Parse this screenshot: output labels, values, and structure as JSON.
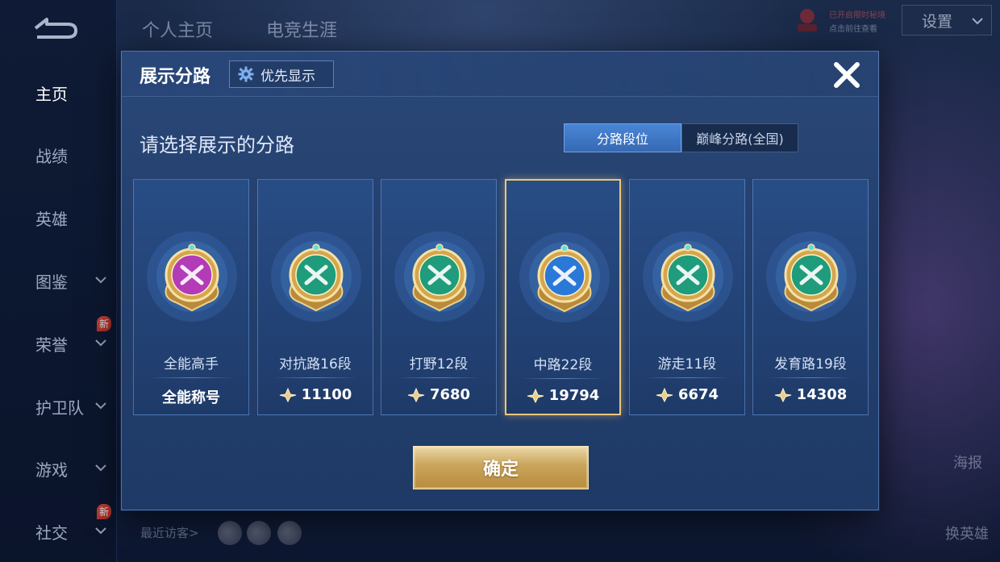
{
  "sidebar": {
    "items": [
      {
        "label": "主页",
        "active": true,
        "has_chevron": false
      },
      {
        "label": "战绩",
        "active": false,
        "has_chevron": false
      },
      {
        "label": "英雄",
        "active": false,
        "has_chevron": false
      },
      {
        "label": "图鉴",
        "active": false,
        "has_chevron": true
      },
      {
        "label": "荣誉",
        "active": false,
        "has_chevron": true,
        "new_tag": "新"
      },
      {
        "label": "护卫队",
        "active": false,
        "has_chevron": true
      },
      {
        "label": "游戏",
        "active": false,
        "has_chevron": true
      },
      {
        "label": "社交",
        "active": false,
        "has_chevron": true,
        "new_tag": "新"
      }
    ]
  },
  "top_tabs": [
    "个人主页",
    "电竞生涯"
  ],
  "header_right": {
    "vip_line1": "已开启限时秘境",
    "vip_line2": "点击前往查看",
    "settings_label": "设置"
  },
  "footer": {
    "recent_visitors_label": "最近访客>",
    "poster_label": "海报",
    "change_hero_label": "换英雄"
  },
  "modal": {
    "title": "展示分路",
    "priority_button_label": "优先显示",
    "prompt": "请选择展示的分路",
    "segments": [
      {
        "label": "分路段位",
        "active": true
      },
      {
        "label": "巅峰分路(全国)",
        "active": false
      }
    ],
    "cards": [
      {
        "rank": "全能高手",
        "score": "全能称号",
        "show_gem": false,
        "selected": false,
        "badge_icon": "all-round-badge-icon",
        "color": "#b43bb8"
      },
      {
        "rank": "对抗路16段",
        "score": "11100",
        "show_gem": true,
        "selected": false,
        "badge_icon": "clash-lane-badge-icon",
        "color": "#1f9c7c"
      },
      {
        "rank": "打野12段",
        "score": "7680",
        "show_gem": true,
        "selected": false,
        "badge_icon": "jungle-badge-icon",
        "color": "#1f9c7c"
      },
      {
        "rank": "中路22段",
        "score": "19794",
        "show_gem": true,
        "selected": true,
        "badge_icon": "mid-lane-badge-icon",
        "color": "#2a78d8"
      },
      {
        "rank": "游走11段",
        "score": "6674",
        "show_gem": true,
        "selected": false,
        "badge_icon": "roam-badge-icon",
        "color": "#1f9c7c"
      },
      {
        "rank": "发育路19段",
        "score": "14308",
        "show_gem": true,
        "selected": false,
        "badge_icon": "farm-lane-badge-icon",
        "color": "#1f9c7c"
      }
    ],
    "confirm_label": "确定"
  },
  "colors": {
    "modal_bg": "#24406e",
    "segment_active": "#3f77c4",
    "confirm_gold": "#c9a45a",
    "selected_border": "#e9c77a"
  }
}
